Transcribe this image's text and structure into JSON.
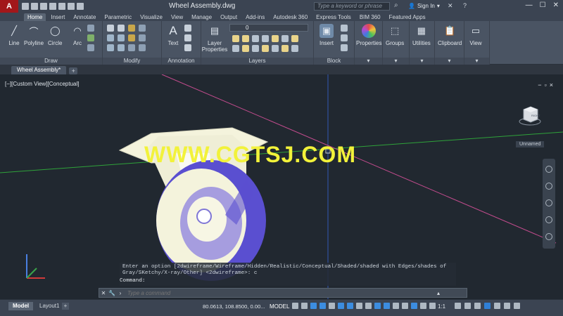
{
  "app": {
    "logo": "A",
    "title": "Wheel Assembly.dwg",
    "search_placeholder": "Type a keyword or phrase",
    "signin": "Sign In",
    "window_controls": [
      "—",
      "☐",
      "✕"
    ]
  },
  "ribbon_tabs": [
    "Home",
    "Insert",
    "Annotate",
    "Parametric",
    "Visualize",
    "View",
    "Manage",
    "Output",
    "Add-ins",
    "Autodesk 360",
    "Express Tools",
    "BIM 360",
    "Featured Apps"
  ],
  "ribbon": {
    "draw": {
      "title": "Draw",
      "tools": [
        "Line",
        "Polyline",
        "Circle",
        "Arc"
      ]
    },
    "modify": {
      "title": "Modify"
    },
    "annotation": {
      "title": "Annotation",
      "text": "Text"
    },
    "layers": {
      "title": "Layers",
      "properties": "Layer\nProperties",
      "current_layer": "0"
    },
    "block": {
      "title": "Block",
      "insert": "Insert"
    },
    "properties": "Properties",
    "groups": "Groups",
    "utilities": "Utilities",
    "clipboard": "Clipboard",
    "view": "View"
  },
  "file_tab": "Wheel Assembly*",
  "viewport": {
    "label": "[−][Custom View][Conceptual]",
    "viewcube_label": "RIGHT",
    "named_view": "Unnamed",
    "watermark": "WWW.CGTSJ.COM"
  },
  "command": {
    "history": "Enter an option [2dwireframe/Wireframe/Hidden/Realistic/Conceptual/Shaded/shaded with Edges/shades of Gray/SKetchy/X-ray/Other] <2dwireframe>:  c",
    "prompt": "Command:",
    "placeholder": "Type a command"
  },
  "status": {
    "model_tab": "Model",
    "layout_tab": "Layout1",
    "coords": "80.0613, 108.8500, 0.00...",
    "model": "MODEL",
    "scale": "1:1"
  },
  "colors": {
    "x_axis": "#2fa33a",
    "y_axis": "#3457b5",
    "accent_line": "#c44c8e",
    "wheel_tint": "#5a4fd0",
    "wheel_body": "#f4f3dc"
  }
}
